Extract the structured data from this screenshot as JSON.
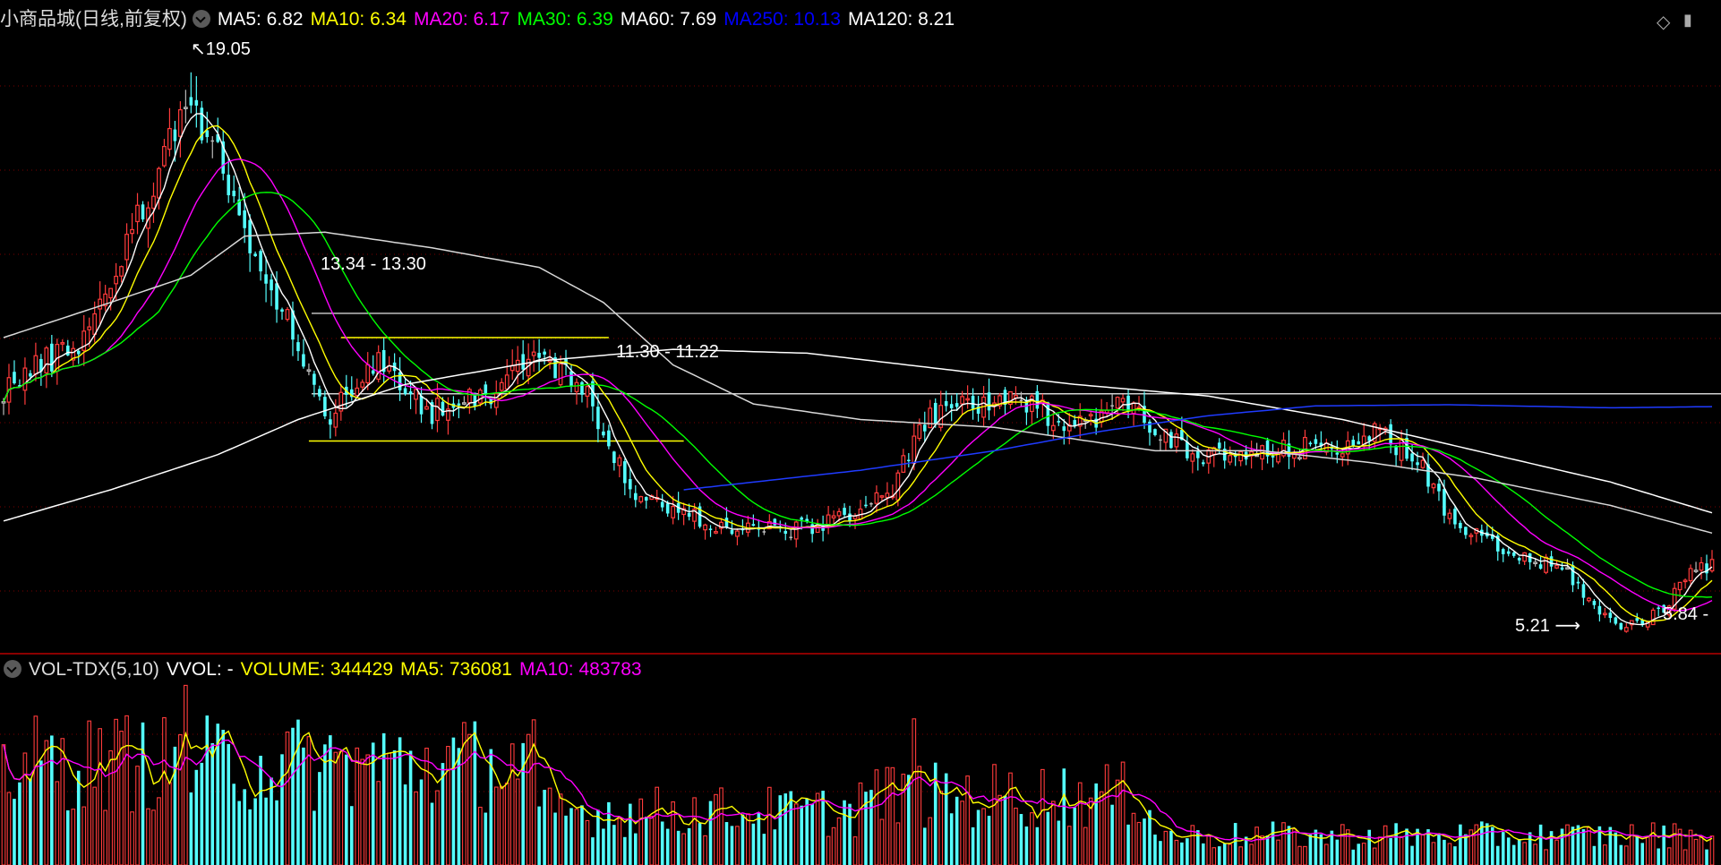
{
  "header": {
    "title": "小商品城(日线,前复权)",
    "indicators": [
      {
        "label": "MA5: 6.82",
        "color": "#ffffff"
      },
      {
        "label": "MA10: 6.34",
        "color": "#ffff00"
      },
      {
        "label": "MA20: 6.17",
        "color": "#ff00ff"
      },
      {
        "label": "MA30: 6.39",
        "color": "#00ff00"
      },
      {
        "label": "MA60: 7.69",
        "color": "#ffffff"
      },
      {
        "label": "MA250: 10.13",
        "color": "#0000ff"
      },
      {
        "label": "MA120: 8.21",
        "color": "#ffffff"
      }
    ]
  },
  "volume_header": {
    "title": "VOL-TDX(5,10)",
    "indicators": [
      {
        "label": "VVOL: -",
        "color": "#ffffff"
      },
      {
        "label": "VOLUME: 344429",
        "color": "#ffff00"
      },
      {
        "label": "MA5: 736081",
        "color": "#ffff00"
      },
      {
        "label": "MA10: 483783",
        "color": "#ff00ff"
      }
    ]
  },
  "annotations": {
    "high": "19.05",
    "range_upper": "13.34 - 13.30",
    "range_lower": "11.30 - 11.22",
    "low": "5.21",
    "last": "5.84 -"
  },
  "colors": {
    "up": "#ff3b3b",
    "down": "#54ffff",
    "flat": "#bbbbbb",
    "grid": "#7a0000",
    "yellow": "#ffff00",
    "white": "#ffffff"
  },
  "chart_data": {
    "type": "candlestick",
    "y_range": [
      4.6,
      20.8
    ],
    "volume_range": [
      0,
      3000000
    ],
    "horizontal_levels": [
      13.32,
      11.26
    ],
    "box": {
      "start_index": 63,
      "end_index": 113,
      "upper": 12.7,
      "lower": 10.05
    },
    "anchors": [
      [
        0,
        11.4
      ],
      [
        15,
        12.7
      ],
      [
        27,
        16.3
      ],
      [
        34,
        19.05
      ],
      [
        40,
        17.5
      ],
      [
        47,
        14.4
      ],
      [
        52,
        13.6
      ],
      [
        60,
        10.6
      ],
      [
        65,
        11.5
      ],
      [
        70,
        12.0
      ],
      [
        75,
        11.3
      ],
      [
        80,
        10.8
      ],
      [
        85,
        11.2
      ],
      [
        92,
        11.3
      ],
      [
        97,
        12.2
      ],
      [
        103,
        12.0
      ],
      [
        110,
        11.0
      ],
      [
        117,
        8.7
      ],
      [
        125,
        8.3
      ],
      [
        135,
        7.8
      ],
      [
        150,
        7.8
      ],
      [
        165,
        8.6
      ],
      [
        172,
        10.5
      ],
      [
        178,
        11.0
      ],
      [
        190,
        11.0
      ],
      [
        200,
        10.5
      ],
      [
        210,
        11.0
      ],
      [
        216,
        10.3
      ],
      [
        222,
        9.6
      ],
      [
        235,
        9.7
      ],
      [
        250,
        10.0
      ],
      [
        256,
        10.2
      ],
      [
        263,
        9.8
      ],
      [
        270,
        8.0
      ],
      [
        280,
        7.2
      ],
      [
        292,
        6.7
      ],
      [
        298,
        5.6
      ],
      [
        303,
        5.3
      ],
      [
        310,
        5.7
      ],
      [
        315,
        6.9
      ],
      [
        319,
        6.82
      ]
    ],
    "ma60_values": [
      [
        0,
        12.7
      ],
      [
        20,
        13.6
      ],
      [
        35,
        14.3
      ],
      [
        45,
        15.3
      ],
      [
        60,
        15.4
      ],
      [
        80,
        15.0
      ],
      [
        100,
        14.5
      ],
      [
        112,
        13.6
      ],
      [
        125,
        12.0
      ],
      [
        140,
        11.0
      ],
      [
        160,
        10.6
      ],
      [
        185,
        10.4
      ],
      [
        215,
        9.8
      ],
      [
        235,
        9.8
      ],
      [
        255,
        9.5
      ],
      [
        275,
        9.1
      ],
      [
        300,
        8.4
      ],
      [
        319,
        7.69
      ]
    ],
    "ma120_values": [
      [
        0,
        8.0
      ],
      [
        20,
        8.8
      ],
      [
        40,
        9.7
      ],
      [
        55,
        10.6
      ],
      [
        75,
        11.5
      ],
      [
        100,
        12.1
      ],
      [
        125,
        12.4
      ],
      [
        150,
        12.3
      ],
      [
        175,
        11.9
      ],
      [
        200,
        11.5
      ],
      [
        225,
        11.2
      ],
      [
        250,
        10.6
      ],
      [
        275,
        9.8
      ],
      [
        300,
        9.0
      ],
      [
        319,
        8.21
      ]
    ],
    "ma250_values": [
      [
        127,
        8.8
      ],
      [
        160,
        9.3
      ],
      [
        185,
        9.8
      ],
      [
        205,
        10.3
      ],
      [
        225,
        10.7
      ],
      [
        245,
        10.95
      ],
      [
        270,
        10.98
      ],
      [
        300,
        10.9
      ],
      [
        319,
        10.93
      ]
    ],
    "candle_count": 320
  }
}
